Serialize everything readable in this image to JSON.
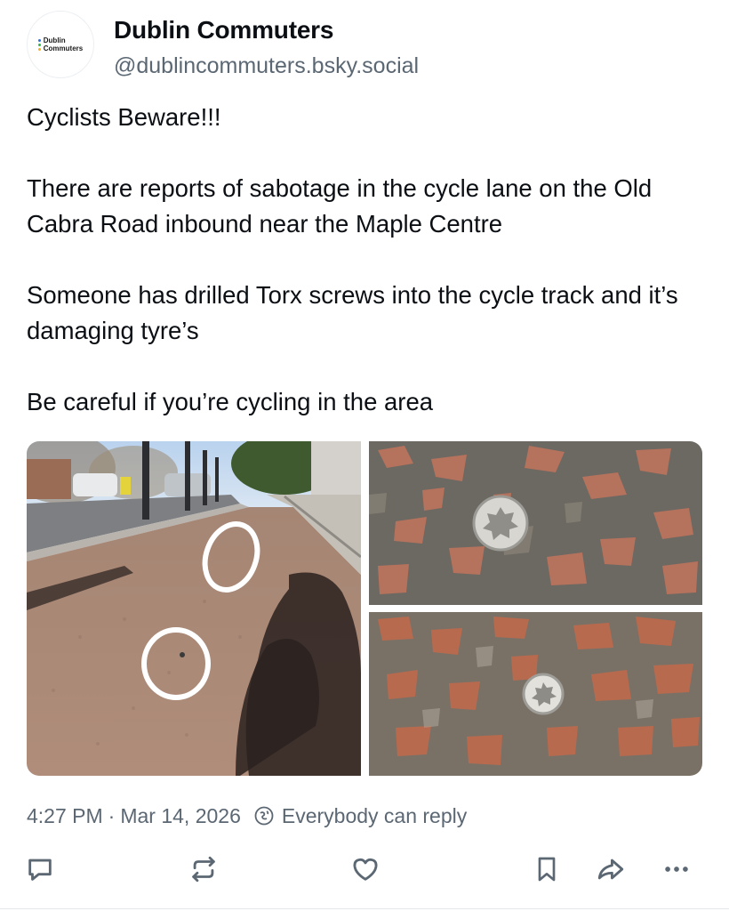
{
  "author": {
    "display_name": "Dublin Commuters",
    "handle": "@dublincommuters.bsky.social",
    "avatar_text": [
      "Dublin",
      "Commuters"
    ],
    "avatar_dot_colors": [
      "#2f6fde",
      "#35b34a",
      "#f2b01e"
    ]
  },
  "post": {
    "paragraphs": [
      "Cyclists Beware!!!",
      "There are reports of sabotage in the cycle lane on the Old Cabra Road inbound near the Maple Centre",
      "Someone has drilled Torx screws into the cycle track and it’s damaging tyre’s",
      "Be careful if you’re cycling in the area"
    ]
  },
  "media": {
    "images": [
      {
        "description_icon": "cycle-lane-photo"
      },
      {
        "description_icon": "torx-screw-closeup-photo"
      },
      {
        "description_icon": "torx-screw-closeup-photo"
      }
    ]
  },
  "meta": {
    "time": "4:27 PM",
    "separator": "·",
    "date": "Mar 14, 2026",
    "reply_setting": "Everybody can reply",
    "reply_icon": "globe-reply-icon"
  },
  "actions": {
    "icons": [
      "reply-icon",
      "repost-icon",
      "like-icon",
      "bookmark-icon",
      "share-icon",
      "more-icon"
    ],
    "icon_color": "#5b6773"
  },
  "colors": {
    "text": "#0b0f14",
    "secondary_text": "#5b6773",
    "background": "#ffffff"
  }
}
